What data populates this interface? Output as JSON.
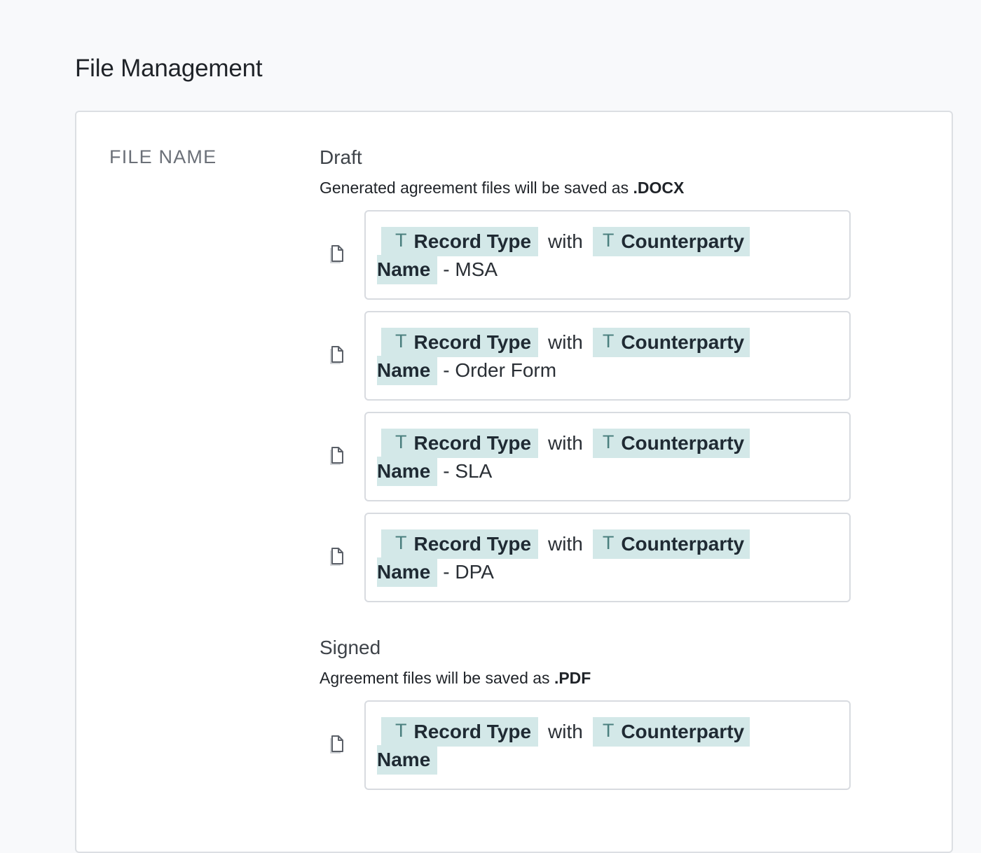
{
  "page": {
    "title": "File Management"
  },
  "section": {
    "label": "FILE NAME"
  },
  "draft": {
    "title": "Draft",
    "desc_prefix": "Generated agreement files will be saved as",
    "desc_ext": ".DOCX",
    "rows": [
      {
        "token1": "Record Type",
        "joiner": "with",
        "token2a": "Counterparty",
        "token2b": "Name",
        "suffix": "- MSA"
      },
      {
        "token1": "Record Type",
        "joiner": "with",
        "token2a": "Counterparty",
        "token2b": "Name",
        "suffix": "- Order Form"
      },
      {
        "token1": "Record Type",
        "joiner": "with",
        "token2a": "Counterparty",
        "token2b": "Name",
        "suffix": "- SLA"
      },
      {
        "token1": "Record Type",
        "joiner": "with",
        "token2a": "Counterparty",
        "token2b": "Name",
        "suffix": "- DPA"
      }
    ]
  },
  "signed": {
    "title": "Signed",
    "desc_prefix": "Agreement files will be saved as",
    "desc_ext": ".PDF",
    "rows": [
      {
        "token1": "Record Type",
        "joiner": "with",
        "token2a": "Counterparty",
        "token2b": "Name",
        "suffix": ""
      }
    ]
  },
  "token_icon": "T",
  "icons": {
    "row_icon": "file-icon",
    "token_icon": "text-type-icon"
  },
  "colors": {
    "chip_bg": "#d3e8e8",
    "chip_icon": "#4a7f7e"
  }
}
